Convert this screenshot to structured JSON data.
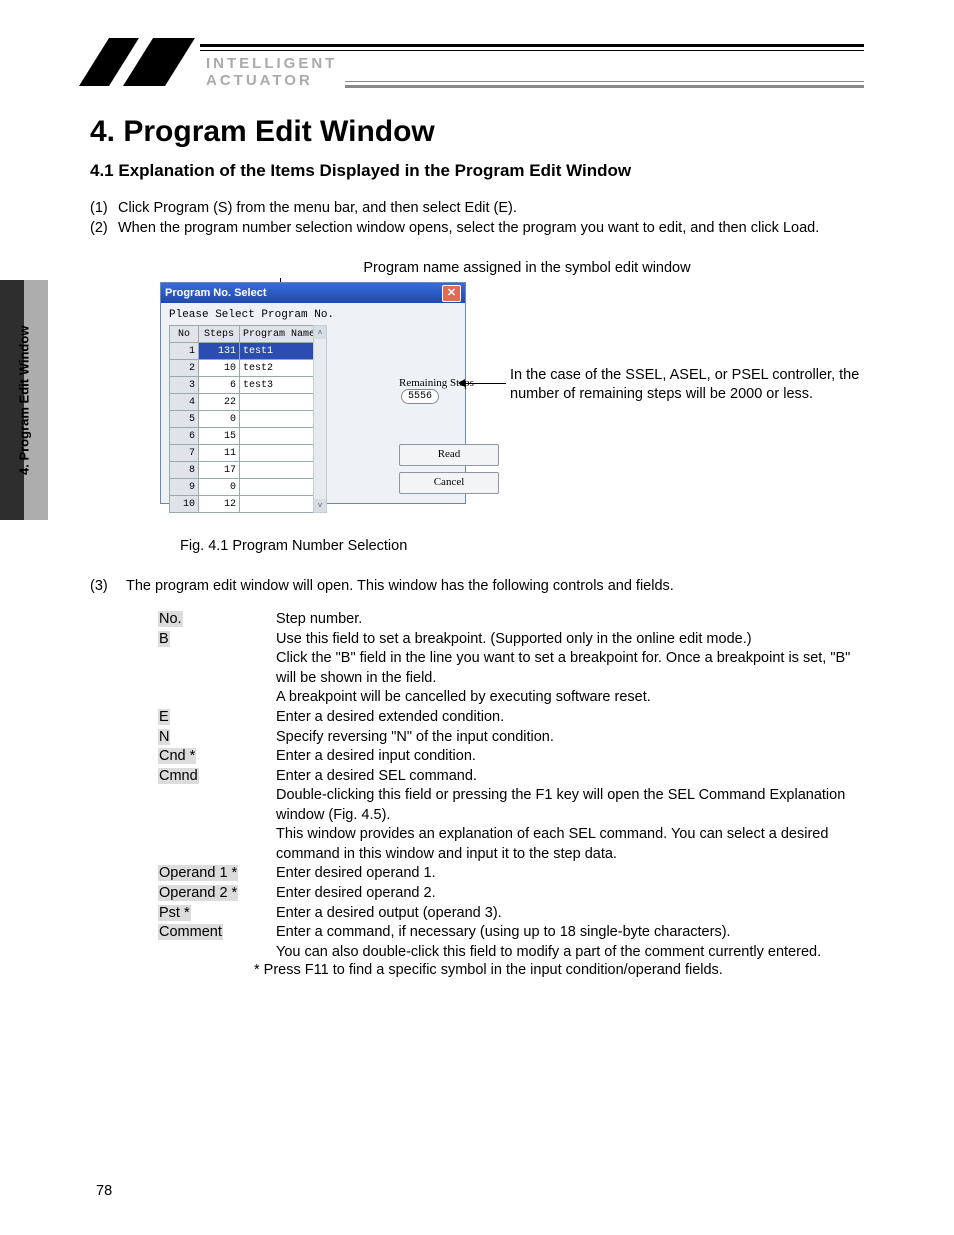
{
  "side_label": "4. Program Edit Window",
  "logo": {
    "line1": "INTELLIGENT",
    "line2": "ACTUATOR"
  },
  "heading": "4.  Program Edit Window",
  "subheading": "4.1    Explanation of the Items Displayed in the Program Edit Window",
  "para": {
    "p1_num": "(1)",
    "p1": "Click Program (S) from the menu bar, and then select Edit (E).",
    "p2_num": "(2)",
    "p2": "When the program number selection window opens, select the program you want to edit, and then click Load."
  },
  "caption_top": "Program name assigned in the symbol edit window",
  "window": {
    "title": "Program No. Select",
    "close_glyph": "✕",
    "prompt": "Please Select Program No.",
    "cols": {
      "no": "No",
      "steps": "Steps",
      "name": "Program Name"
    },
    "rows": [
      {
        "no": "1",
        "steps": "131",
        "name": "test1"
      },
      {
        "no": "2",
        "steps": "10",
        "name": "test2"
      },
      {
        "no": "3",
        "steps": "6",
        "name": "test3"
      },
      {
        "no": "4",
        "steps": "22",
        "name": ""
      },
      {
        "no": "5",
        "steps": "0",
        "name": ""
      },
      {
        "no": "6",
        "steps": "15",
        "name": ""
      },
      {
        "no": "7",
        "steps": "11",
        "name": ""
      },
      {
        "no": "8",
        "steps": "17",
        "name": ""
      },
      {
        "no": "9",
        "steps": "0",
        "name": ""
      },
      {
        "no": "10",
        "steps": "12",
        "name": ""
      }
    ],
    "remaining_label": "Remaining Steps",
    "remaining_value": "5556",
    "btn_read": "Read",
    "btn_cancel": "Cancel",
    "scroll_up": "˄",
    "scroll_down": "˅"
  },
  "annotation": "In the case of the SSEL, ASEL, or PSEL controller, the number of remaining steps will be 2000 or less.",
  "fig_caption": "Fig. 4.1 Program Number Selection",
  "p3_num": "(3)",
  "p3": "The program edit window will open. This window has the following controls and fields.",
  "defs": [
    {
      "term": "No.",
      "desc": "Step number."
    },
    {
      "term": "B",
      "desc": "Use this field to set a breakpoint. (Supported only in the online edit mode.)\nClick the \"B\" field in the line you want to set a breakpoint for. Once a breakpoint is set, \"B\" will be shown in the field.\nA breakpoint will be cancelled by executing software reset."
    },
    {
      "term": "E",
      "desc": "Enter a desired extended condition."
    },
    {
      "term": "N",
      "desc": "Specify reversing \"N\" of the input condition."
    },
    {
      "term": "Cnd *",
      "desc": "Enter a desired input condition."
    },
    {
      "term": "Cmnd",
      "desc": "Enter a desired SEL command.\nDouble-clicking this field or pressing the F1 key will open the SEL Command Explanation window (Fig. 4.5).\nThis window provides an explanation of each SEL command. You can select a desired command in this window and input it to the step data."
    },
    {
      "term": "Operand 1 *",
      "desc": "Enter desired operand 1."
    },
    {
      "term": "Operand 2 *",
      "desc": "Enter desired operand 2."
    },
    {
      "term": "Pst *",
      "desc": "Enter a desired output (operand 3)."
    },
    {
      "term": "Comment",
      "desc": "Enter a command, if necessary (using up to 18 single-byte characters).\nYou can also double-click this field to modify a part of the comment currently entered."
    }
  ],
  "footnote": "* Press F11 to find a specific symbol in the input condition/operand fields.",
  "page_number": "78"
}
